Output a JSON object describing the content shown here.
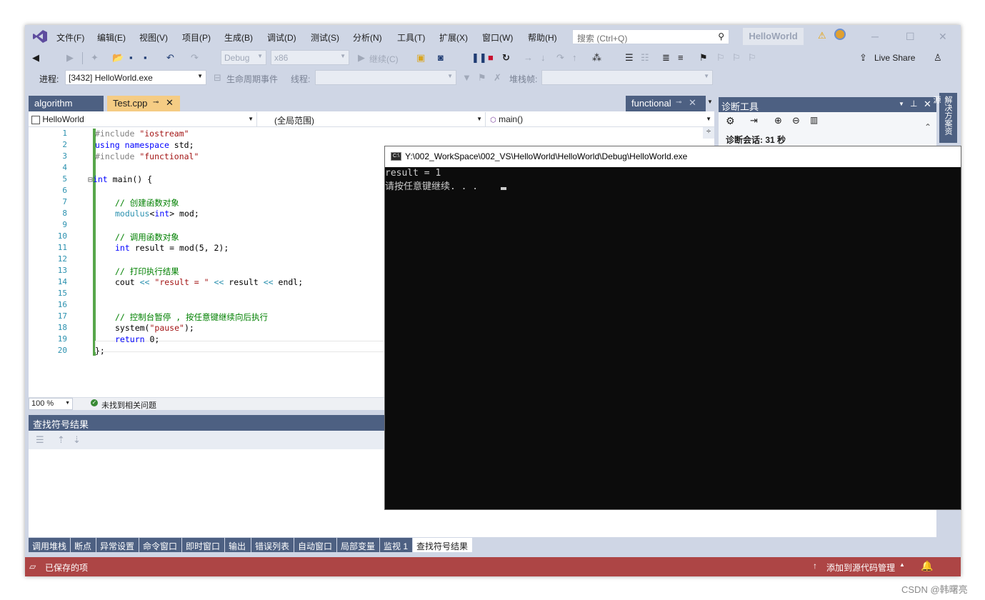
{
  "menu": [
    "文件(F)",
    "编辑(E)",
    "视图(V)",
    "项目(P)",
    "生成(B)",
    "调试(D)",
    "测试(S)",
    "分析(N)",
    "工具(T)",
    "扩展(X)",
    "窗口(W)",
    "帮助(H)"
  ],
  "search": {
    "placeholder": "搜索 (Ctrl+Q)"
  },
  "solution_name": "HelloWorld",
  "toolbar": {
    "config": "Debug",
    "platform": "x86",
    "continue_label": "继续(C)",
    "live_share": "Live Share",
    "process_label": "进程:",
    "process_value": "[3432] HelloWorld.exe",
    "lifecycle_label": "生命周期事件",
    "thread_label": "线程:",
    "stack_label": "堆栈帧:"
  },
  "doc_tabs": {
    "algorithm": "algorithm",
    "test": "Test.cpp",
    "functional": "functional"
  },
  "nav": {
    "project": "HelloWorld",
    "scope": "(全局范围)",
    "member": "main()"
  },
  "line_numbers": [
    "1",
    "2",
    "3",
    "4",
    "5",
    "6",
    "7",
    "8",
    "9",
    "10",
    "11",
    "12",
    "13",
    "14",
    "15",
    "16",
    "17",
    "18",
    "19",
    "20"
  ],
  "code": {
    "l1_pp": "#include ",
    "l1_str": "\"iostream\"",
    "l2_kw1": "using",
    "l2_kw2": "namespace",
    "l2_rest": " std;",
    "l3_pp": "#include ",
    "l3_str": "\"functional\"",
    "l5_fold": "⊟",
    "l5_kw": "int",
    "l5_rest": " main() {",
    "l7": "// 创建函数对象",
    "l8_ty": "modulus",
    "l8_kw": "int",
    "l8_rest": " mod;",
    "l10": "// 调用函数对象",
    "l11_kw": "int",
    "l11_rest": " result = mod(5, 2);",
    "l13": "// 打印执行结果",
    "l14_a": "cout ",
    "l14_op1": "<<",
    "l14_str": " \"result = \" ",
    "l14_op2": "<<",
    "l14_b": " result ",
    "l14_op3": "<<",
    "l14_c": " endl;",
    "l17": "// 控制台暂停 , 按任意键继续向后执行",
    "l18_a": "system(",
    "l18_str": "\"pause\"",
    "l18_b": ");",
    "l19_kw": "return",
    "l19_rest": " 0;",
    "l20": "};"
  },
  "editor_status": {
    "zoom": "100 %",
    "issues": "未找到相关问题"
  },
  "diag": {
    "title": "诊断工具",
    "session": "诊断会话: 31 秒"
  },
  "side_strip": "解决方案资源",
  "console": {
    "title": "Y:\\002_WorkSpace\\002_VS\\HelloWorld\\HelloWorld\\Debug\\HelloWorld.exe",
    "icon_text": "C:\\",
    "line1": "result = 1",
    "line2": "请按任意键继续. . ."
  },
  "find_panel": {
    "title": "查找符号结果"
  },
  "bottom_tabs": [
    "调用堆栈",
    "断点",
    "异常设置",
    "命令窗口",
    "即时窗口",
    "输出",
    "错误列表",
    "自动窗口",
    "局部变量",
    "监视 1",
    "查找符号结果"
  ],
  "status": {
    "saved": "已保存的项",
    "source_control": "添加到源代码管理"
  },
  "watermark": "CSDN @韩曙亮"
}
